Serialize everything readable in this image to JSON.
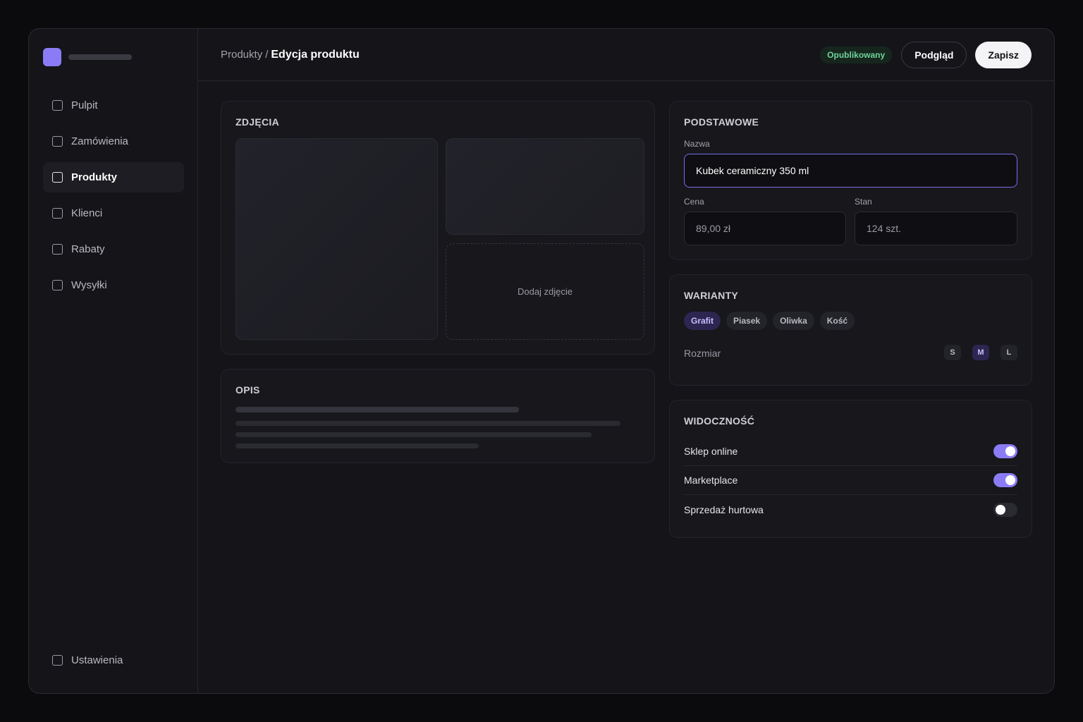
{
  "sidebar": {
    "items": [
      {
        "label": "Pulpit"
      },
      {
        "label": "Zamówienia"
      },
      {
        "label": "Produkty"
      },
      {
        "label": "Klienci"
      },
      {
        "label": "Rabaty"
      },
      {
        "label": "Wysyłki"
      }
    ],
    "active_item": "Produkty",
    "settings_label": "Ustawienia"
  },
  "header": {
    "breadcrumb_parent": "Produkty",
    "breadcrumb_separator": "/",
    "breadcrumb_current": "Edycja produktu",
    "status": "Opublikowany",
    "preview_label": "Podgląd",
    "save_label": "Zapisz"
  },
  "photos": {
    "title": "ZDJĘCIA",
    "add_label": "Dodaj zdjęcie"
  },
  "description": {
    "title": "OPIS"
  },
  "basics": {
    "title": "PODSTAWOWE",
    "name_label": "Nazwa",
    "name_value": "Kubek ceramiczny 350 ml",
    "price_label": "Cena",
    "price_value": "89,00 zł",
    "stock_label": "Stan",
    "stock_value": "124 szt."
  },
  "variants": {
    "title": "WARIANTY",
    "colors": [
      "Grafit",
      "Piasek",
      "Oliwka",
      "Kość"
    ],
    "selected_color": "Grafit",
    "size_label": "Rozmiar",
    "sizes": [
      "S",
      "M",
      "L"
    ],
    "selected_size": "M"
  },
  "visibility": {
    "title": "WIDOCZNOŚĆ",
    "channels": [
      {
        "label": "Sklep online",
        "enabled": true
      },
      {
        "label": "Marketplace",
        "enabled": true
      },
      {
        "label": "Sprzedaż hurtowa",
        "enabled": false
      }
    ]
  },
  "colors": {
    "accent": "#8b7cf6",
    "status_green": "#6fd39a",
    "background": "#141419"
  }
}
